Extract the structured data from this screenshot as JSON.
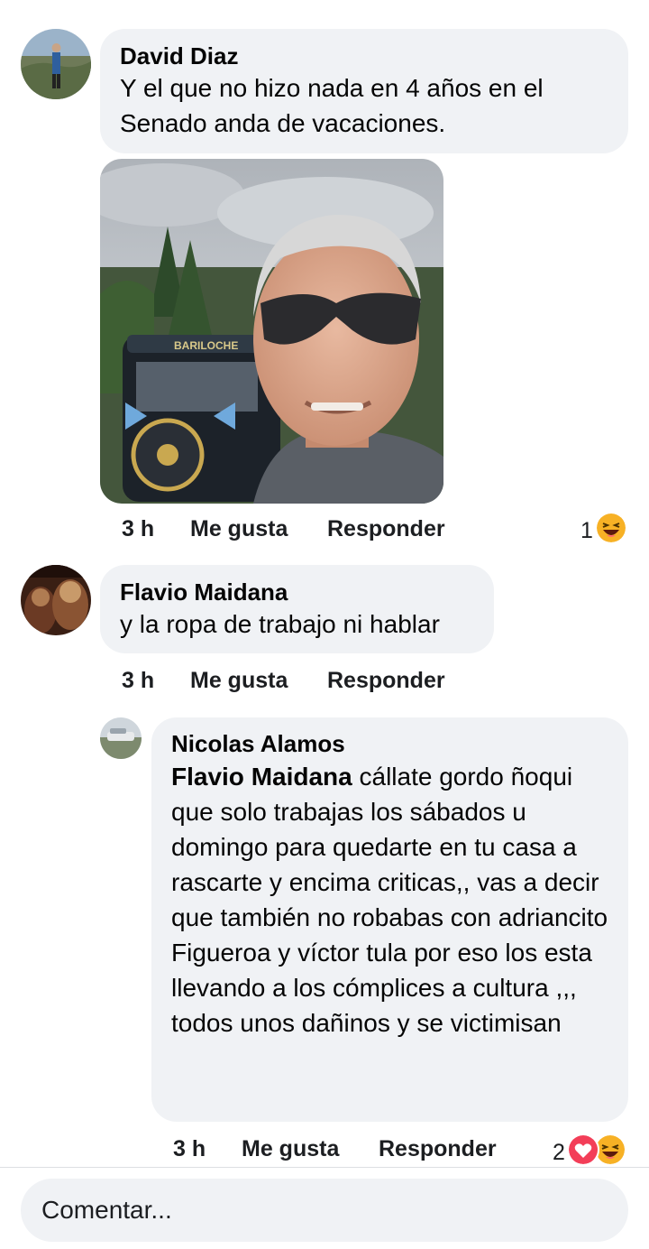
{
  "comments": [
    {
      "author": "David Diaz",
      "text": "Y el que no hizo nada en 4 años en el Senado anda de vacaciones.",
      "time": "3 h",
      "like_label": "Me gusta",
      "reply_label": "Responder",
      "reaction_count": "1",
      "reactions": [
        "haha-emoji"
      ],
      "attachment": "photo",
      "sign_text": "BARILOCHE"
    },
    {
      "author": "Flavio Maidana",
      "text": "y la ropa de trabajo ni hablar",
      "time": "3 h",
      "like_label": "Me gusta",
      "reply_label": "Responder"
    },
    {
      "author": "Nicolas Alamos",
      "mention": "Flavio Maidana",
      "text": " cállate gordo ñoqui que solo trabajas los sábados u domingo para quedarte en tu casa a rascarte y encima criticas,, vas a decir que también no robabas con adriancito Figueroa y víctor tula por eso los esta llevando a los cómplices a cultura ,,, todos unos dañinos y se victimisan",
      "time": "3 h",
      "like_label": "Me gusta",
      "reply_label": "Responder",
      "reaction_count": "2",
      "reactions": [
        "love-emoji",
        "haha-emoji"
      ],
      "is_reply": true
    }
  ],
  "composer": {
    "placeholder": "Comentar..."
  },
  "colors": {
    "bubble": "#f0f2f5",
    "text": "#050505",
    "love": "#f33e58",
    "haha": "#f7b125"
  }
}
